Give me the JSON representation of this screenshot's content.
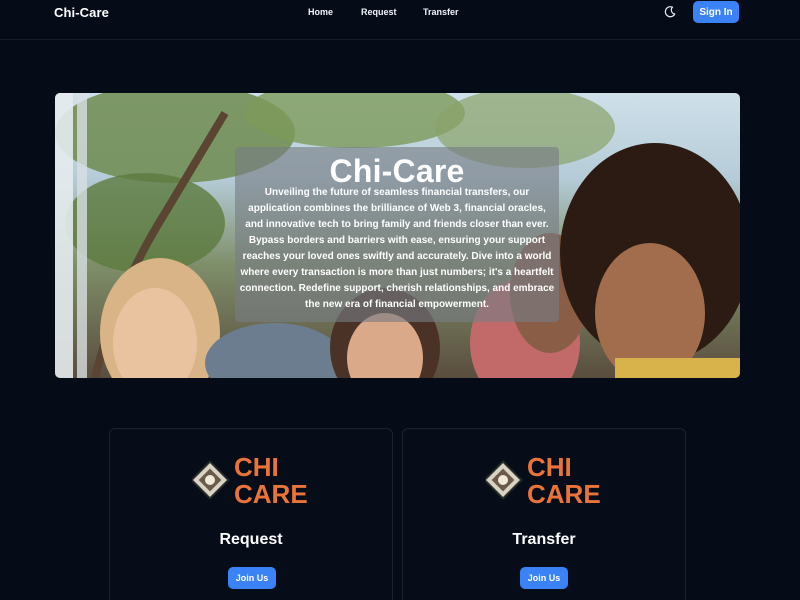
{
  "navbar": {
    "brand": "Chi-Care",
    "links": [
      "Home",
      "Request",
      "Transfer"
    ],
    "signin_label": "Sign In"
  },
  "hero": {
    "title": "Chi-Care",
    "description": "Unveiling the future of seamless financial transfers, our application combines the brilliance of Web 3, financial oracles, and innovative tech to bring family and friends closer than ever. Bypass borders and barriers with ease, ensuring your support reaches your loved ones swiftly and accurately. Dive into a world where every transaction is more than just numbers; it's a heartfelt connection. Redefine support, cherish relationships, and embrace the new era of financial empowerment."
  },
  "cards": [
    {
      "logo_line1": "CHI",
      "logo_line2": "CARE",
      "title": "Request",
      "button_label": "Join Us"
    },
    {
      "logo_line1": "CHI",
      "logo_line2": "CARE",
      "title": "Transfer",
      "button_label": "Join Us"
    }
  ],
  "colors": {
    "background": "#060b18",
    "accent": "#3b82f6",
    "logo_orange": "#e8743a"
  },
  "icons": {
    "theme_toggle": "moon-icon",
    "logo_mark": "chi-care-logo-mark"
  }
}
